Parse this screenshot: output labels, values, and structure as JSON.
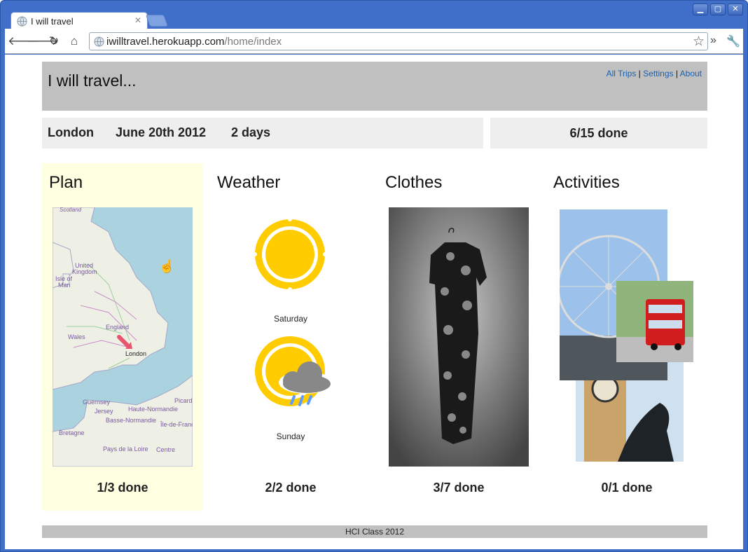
{
  "browser": {
    "tab_title": "I will travel",
    "url_host": "iwilltravel.herokuapp.com",
    "url_path": "/home/index"
  },
  "header": {
    "title": "I will travel...",
    "nav": [
      "All Trips",
      "Settings",
      "About"
    ],
    "separator": "|"
  },
  "trip": {
    "city": "London",
    "date": "June 20th 2012",
    "duration": "2 days",
    "overall_done": "6/15 done"
  },
  "columns": {
    "plan": {
      "title": "Plan",
      "done": "1/3 done"
    },
    "weather": {
      "title": "Weather",
      "done": "2/2 done",
      "days": [
        "Saturday",
        "Sunday"
      ]
    },
    "clothes": {
      "title": "Clothes",
      "done": "3/7 done"
    },
    "activities": {
      "title": "Activities",
      "done": "0/1 done"
    }
  },
  "map_labels": [
    "Scotland",
    "United Kingdom",
    "Isle of Man",
    "England",
    "Wales",
    "London",
    "Guernsey",
    "Jersey",
    "Haute-Normandie",
    "Basse-Normandie",
    "Bretagne",
    "Pays de la Loire",
    "Centre",
    "Picardie",
    "Île-de-France"
  ],
  "footer": {
    "text": "HCI Class 2012"
  },
  "colors": {
    "header_bg": "#c0c0c0",
    "info_bg": "#eeeeee",
    "plan_bg": "#ffffe2",
    "link": "#1a5fb0",
    "sun": "#ffcc00"
  }
}
